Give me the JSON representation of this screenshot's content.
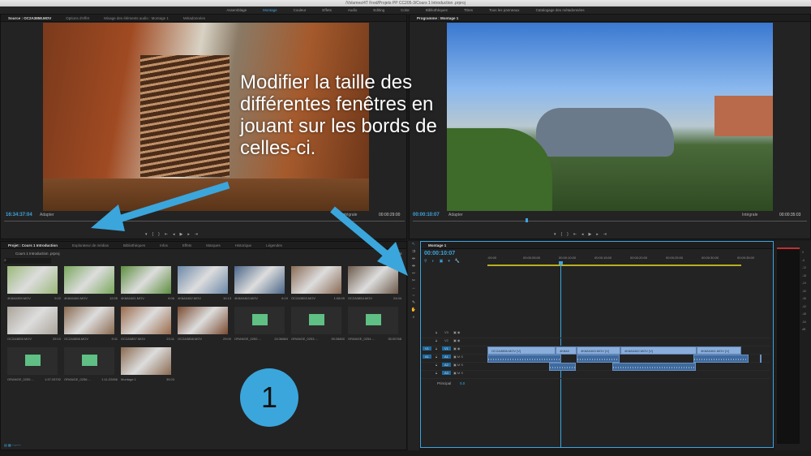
{
  "window": {
    "title": "/Volumes/4T Fred/Projets PP CC205-3/Cours 1 Introduction .prproj"
  },
  "workspaces": [
    "Assemblage",
    "Montage",
    "Couleur",
    "Effets",
    "Audio",
    "Editing",
    "Color",
    "Bibliothèques",
    "Titres",
    "Tous les panneaux",
    "Catalogage des métadonnées"
  ],
  "source": {
    "tabs": [
      "Source : OC2A3858.MOV",
      "Options d'effet",
      "Mixage des éléments audio : Montage 1",
      "Métadonnées"
    ],
    "timecode": "16:34:37:04",
    "fit": "Adapter",
    "quality": "Intégrale",
    "duration": "00:00:29:00"
  },
  "program": {
    "tab": "Programme : Montage 1",
    "timecode": "00:00:10:07",
    "fit": "Adapter",
    "quality": "Intégrale",
    "duration": "00:00:35:03"
  },
  "project": {
    "tabs": [
      "Projet : Cours 1 Introduction",
      "Explorateur de médias",
      "Bibliothèques",
      "Infos",
      "Effets",
      "Marques",
      "Historique",
      "Légendes"
    ],
    "file": "Cours 1 Introduction .prproj",
    "count": "17 éléments",
    "items": [
      {
        "name": "4K8A0459.MOV",
        "dur": "9:22",
        "kind": "v",
        "c": "#9ab87a"
      },
      {
        "name": "4K8A0460.MOV",
        "dur": "12:05",
        "kind": "v",
        "c": "#7aa85c"
      },
      {
        "name": "4K8A0461.MOV",
        "dur": "6:06",
        "kind": "v",
        "c": "#5d8e3e"
      },
      {
        "name": "4K8A0462.MOV",
        "dur": "10:13",
        "kind": "v",
        "c": "#6c88a8"
      },
      {
        "name": "4K8A0463.MOV",
        "dur": "6:19",
        "kind": "v",
        "c": "#4a6688"
      },
      {
        "name": "OC2A3853.MOV",
        "dur": "1:08:09",
        "kind": "v",
        "c": "#8a6b55"
      },
      {
        "name": "OC2A3854.MOV",
        "dur": "24:04",
        "kind": "v",
        "c": "#6d5a4a"
      },
      {
        "name": "OC2A3855.MOV",
        "dur": "29:10",
        "kind": "v",
        "c": "#aaa49a"
      },
      {
        "name": "OC2A3856.MOV",
        "dur": "9:11",
        "kind": "v",
        "c": "#8a6a50"
      },
      {
        "name": "OC2A3857.MOV",
        "dur": "23:11",
        "kind": "v",
        "c": "#9a6a4a"
      },
      {
        "name": "OC2A3858.MOV",
        "dur": "29:00",
        "kind": "v",
        "c": "#7a4a30"
      },
      {
        "name": "ORANGE_0252....",
        "dur": "24:36864",
        "kind": "a"
      },
      {
        "name": "ORANGE_0253....",
        "dur": "39:28800",
        "kind": "a"
      },
      {
        "name": "ORANGE_0254....",
        "dur": "35:00768",
        "kind": "a"
      },
      {
        "name": "ORANGE_0255....",
        "dur": "1:37:33792",
        "kind": "a"
      },
      {
        "name": "ORANGE_0256....",
        "dur": "1:11:22656",
        "kind": "a"
      },
      {
        "name": "Montage 1",
        "dur": "35:03",
        "kind": "v",
        "c": "#8a6a50"
      }
    ]
  },
  "timeline": {
    "tab": "Montage 1",
    "timecode": "00:00:10:07",
    "ruler": [
      ":00:00",
      "00:00:05:00",
      "00:00:10:00",
      "00:00:15:00",
      "00:00:20:00",
      "00:00:25:00",
      "00:00:30:00",
      "00:00:35:00"
    ],
    "tracks": [
      "V3",
      "V2",
      "V1",
      "A1",
      "A2",
      "A3"
    ],
    "master": "Principal",
    "master_val": "0,0",
    "clips": [
      "OC2A3856.MOV [V]",
      "4K8A0",
      "4K8A0463.MOV [V]",
      "4K8A0462.MOV [V]",
      "4K8A0461.MOV [V]"
    ]
  },
  "annotation": {
    "text": "Modifier la taille des différentes fenêtres en jouant sur les bords de celles-ci.",
    "step": "1"
  },
  "colors": {
    "accent": "#3da5e0",
    "arrow": "#3ba6dc"
  }
}
